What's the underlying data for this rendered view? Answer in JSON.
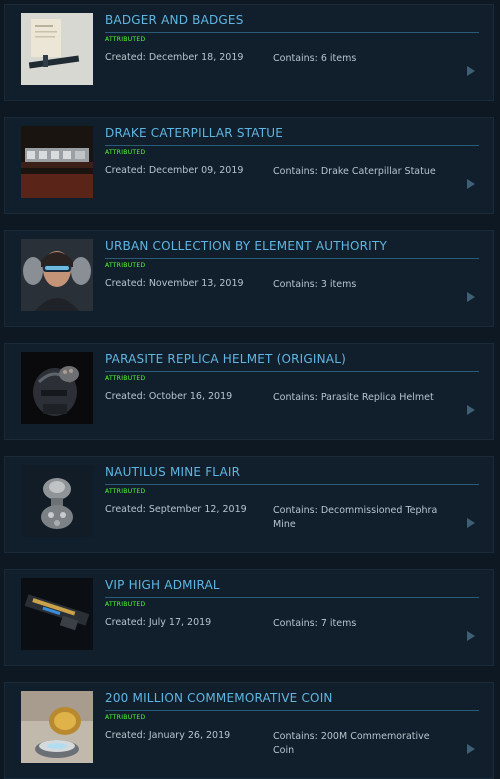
{
  "items": [
    {
      "title": "BADGER AND BADGES",
      "status": "ATTRIBUTED",
      "created": "Created: December 18, 2019",
      "contains": "Contains: 6 items",
      "thumb": "badger-badges-thumbnail"
    },
    {
      "title": "DRAKE CATERPILLAR STATUE",
      "status": "ATTRIBUTED",
      "created": "Created: December 09, 2019",
      "contains": "Contains: Drake Caterpillar Statue",
      "thumb": "drake-caterpillar-statue-thumbnail"
    },
    {
      "title": "URBAN COLLECTION BY ELEMENT AUTHORITY",
      "status": "ATTRIBUTED",
      "created": "Created: November 13, 2019",
      "contains": "Contains: 3 items",
      "thumb": "urban-collection-thumbnail"
    },
    {
      "title": "PARASITE REPLICA HELMET (ORIGINAL)",
      "status": "ATTRIBUTED",
      "created": "Created: October 16, 2019",
      "contains": "Contains: Parasite Replica Helmet",
      "thumb": "parasite-helmet-thumbnail"
    },
    {
      "title": "NAUTILUS MINE FLAIR",
      "status": "ATTRIBUTED",
      "created": "Created: September 12, 2019",
      "contains": "Contains: Decommissioned Tephra Mine",
      "thumb": "nautilus-mine-thumbnail"
    },
    {
      "title": "VIP HIGH ADMIRAL",
      "status": "ATTRIBUTED",
      "created": "Created: July 17, 2019",
      "contains": "Contains: 7 items",
      "thumb": "vip-high-admiral-thumbnail"
    },
    {
      "title": "200 MILLION COMMEMORATIVE COIN",
      "status": "ATTRIBUTED",
      "created": "Created: January 26, 2019",
      "contains": "Contains: 200M Commemorative Coin",
      "thumb": "commemorative-coin-thumbnail"
    }
  ],
  "colors": {
    "accent": "#5fb6e3",
    "attributed": "#55ff34",
    "background": "#0d1823"
  },
  "icons": {
    "open": "play-arrow-icon"
  }
}
